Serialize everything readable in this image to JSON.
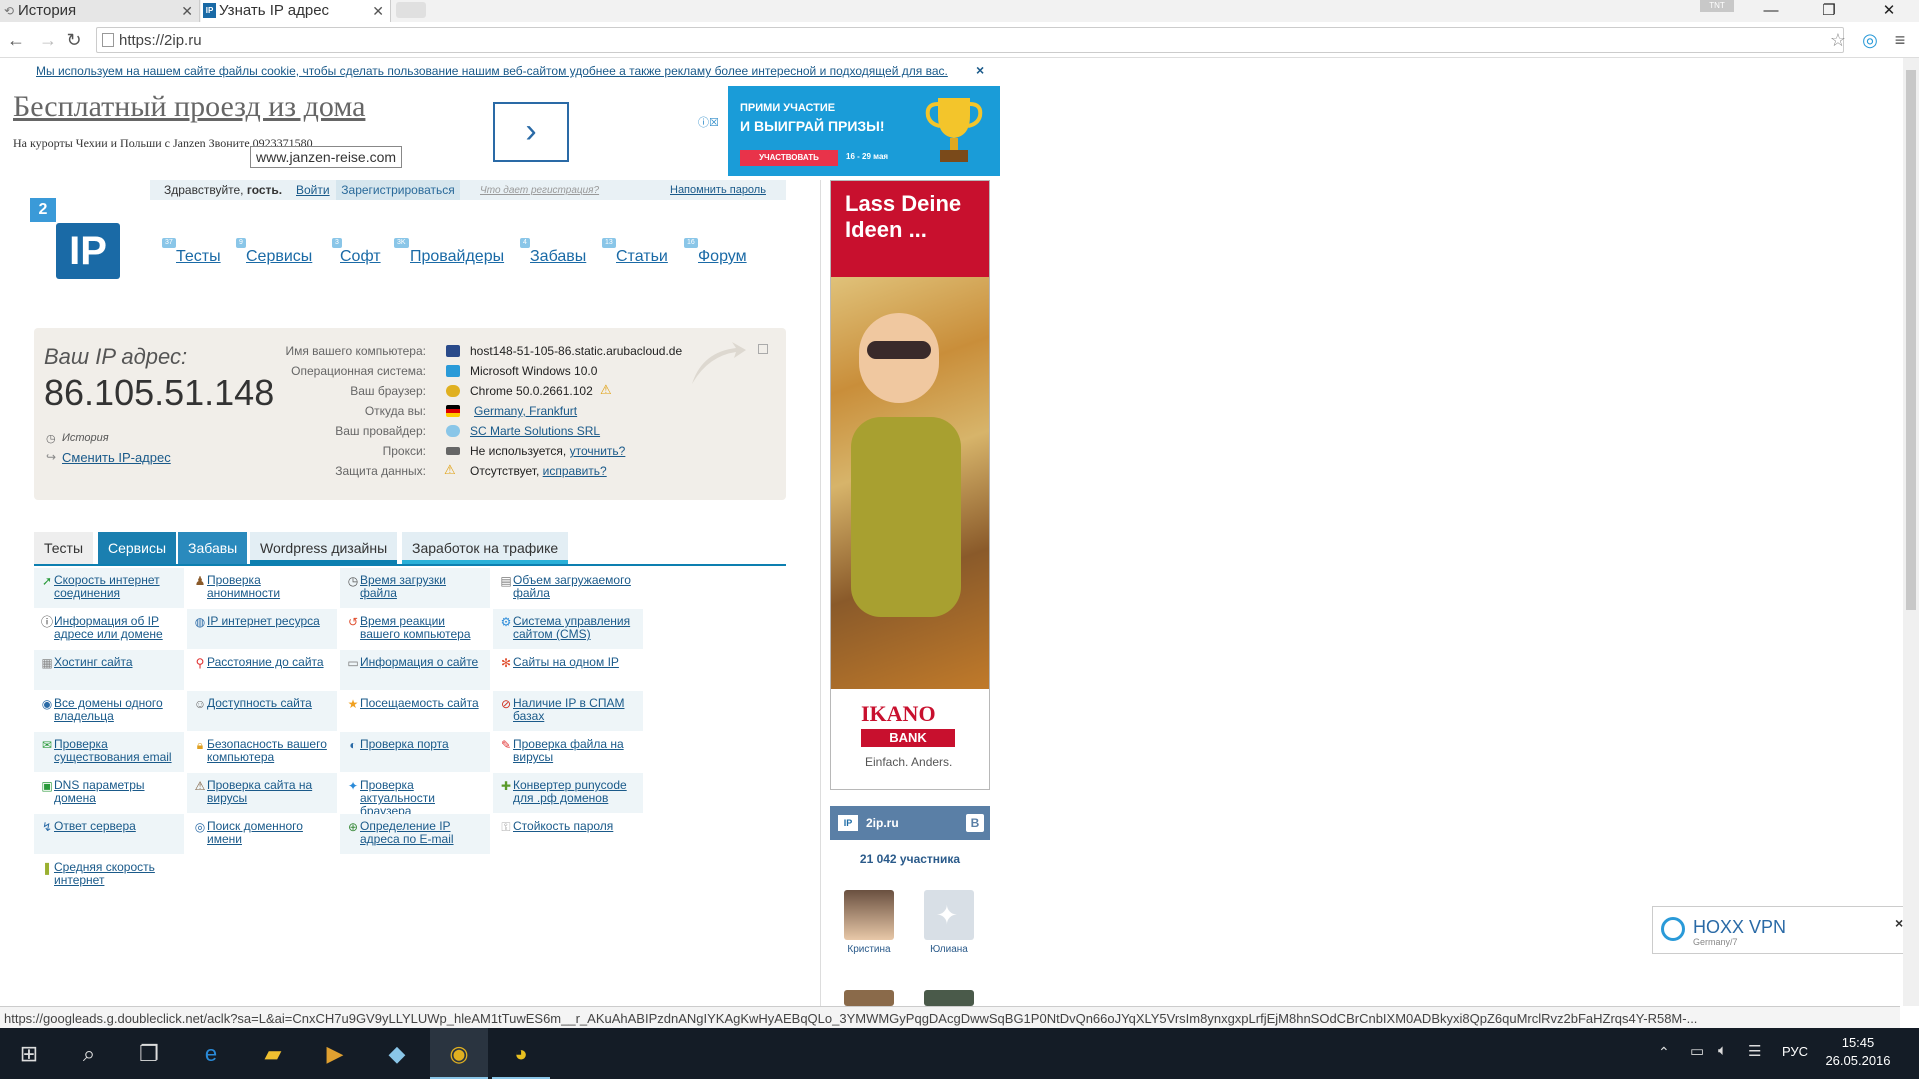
{
  "browser": {
    "tabs": [
      {
        "label": "История"
      },
      {
        "label": "Узнать IP адрес"
      }
    ],
    "badge": "TNT",
    "url": "https://2ip.ru"
  },
  "cookie": {
    "text": "Мы используем на нашем сайте файлы cookie, чтобы сделать пользование нашим веб-сайтом удобнее а также рекламу более интересной и подходящей для вас.",
    "close": "×"
  },
  "ad": {
    "title": "Бесплатный проезд из дома",
    "subtitle": "На курорты Чехии и Польши с Janzen Звоните 0923371580",
    "tooltip": "www.janzen-reise.com",
    "arrow": "›",
    "dots": "● ○"
  },
  "prize": {
    "line1": "ПРИМИ УЧАСТИЕ",
    "line2": "И ВЫИГРАЙ ПРИЗЫ!",
    "button": "УЧАСТВОВАТЬ",
    "dates": "16 - 29 мая"
  },
  "login": {
    "greeting": "Здравствуйте, ",
    "guest": "гость.",
    "login": "Войти",
    "register": "Зарегистрироваться",
    "why": "Что дает регистрация?",
    "remind": "Напомнить пароль"
  },
  "logo": {
    "num": "2",
    "text": "IP"
  },
  "menu": [
    {
      "label": "Тесты",
      "badge": "37"
    },
    {
      "label": "Сервисы",
      "badge": "9"
    },
    {
      "label": "Софт",
      "badge": "3"
    },
    {
      "label": "Провайдеры",
      "badge": "3K"
    },
    {
      "label": "Забавы",
      "badge": "4"
    },
    {
      "label": "Статьи",
      "badge": "13"
    },
    {
      "label": "Форум",
      "badge": "16"
    }
  ],
  "ipinfo": {
    "label": "Ваш IP адрес:",
    "ip": "86.105.51.148",
    "history": "История",
    "change": "Сменить IP-адрес",
    "rows": [
      {
        "label": "Имя вашего компьютера:",
        "value": "host148-51-105-86.static.arubacloud.de",
        "link": ""
      },
      {
        "label": "Операционная система:",
        "value": "Microsoft Windows 10.0",
        "link": ""
      },
      {
        "label": "Ваш браузер:",
        "value": "Chrome 50.0.2661.102",
        "link": ""
      },
      {
        "label": "Откуда вы:",
        "value": "",
        "link": "Germany, Frankfurt"
      },
      {
        "label": "Ваш провайдер:",
        "value": "",
        "link": "SC Marte Solutions SRL"
      },
      {
        "label": "Прокси:",
        "value": "Не используется, ",
        "link": "уточнить?"
      },
      {
        "label": "Защита данных:",
        "value": "Отсутствует, ",
        "link": "исправить?"
      }
    ]
  },
  "tabs": [
    "Тесты",
    "Сервисы",
    "Забавы",
    "Wordpress дизайны",
    "Заработок на трафике"
  ],
  "services": [
    [
      "Скорость интернет соединения",
      "Проверка анонимности",
      "Время загрузки файла",
      "Объем загружаемого файла"
    ],
    [
      "Информация об IP адресе или домене",
      "IP интернет ресурса",
      "Время реакции вашего компьютера",
      "Система управления сайтом (CMS)"
    ],
    [
      "Хостинг сайта",
      "Расстояние до сайта",
      "Информация о сайте",
      "Сайты на одном IP"
    ],
    [
      "Все домены одного владельца",
      "Доступность сайта",
      "Посещаемость сайта",
      "Наличие IP в СПАМ базах"
    ],
    [
      "Проверка существования email",
      "Безопасность вашего компьютера",
      "Проверка порта",
      "Проверка файла на вирусы"
    ],
    [
      "DNS параметры домена",
      "Проверка сайта на вирусы",
      "Проверка актуальности браузера",
      "Конвертер punycode для .рф доменов"
    ],
    [
      "Ответ сервера",
      "Поиск доменного имени",
      "Определение IP адреса по E-mail",
      "Стойкость пароля"
    ],
    [
      "Средняя скорость интернет",
      "",
      "",
      ""
    ]
  ],
  "banner": {
    "line1": "Lass Deine",
    "line2": "Ideen ...",
    "brand": "IKANO",
    "brand2": "BANK",
    "slogan": "Einfach. Anders."
  },
  "vk": {
    "title": "2ip.ru",
    "count": "21 042 участника",
    "members": [
      "Кристина",
      "Юлиана"
    ]
  },
  "hoxx": {
    "title": "HOXX VPN",
    "sub": "Germany/7",
    "close": "×"
  },
  "status": "https://googleads.g.doubleclick.net/aclk?sa=L&ai=CnxCH7u9GV9yLLYLUWp_hleAM1tTuwES6m__r_AKuAhABIPzdnANgIYKAgKwHyAEBqQLo_3YMWMGyPqgDAcgDwwSqBG1P0NtDvQn66oJYqXLY5VrsIm8ynxgxpLrfjEjM8hnSOdCBrCnbIXM0ADBkyxi8QpZ6quMrclRvz2bFaHZrqs4Y-R58M-...",
  "taskbar": {
    "lang": "РУС",
    "time": "15:45",
    "date": "26.05.2016"
  }
}
